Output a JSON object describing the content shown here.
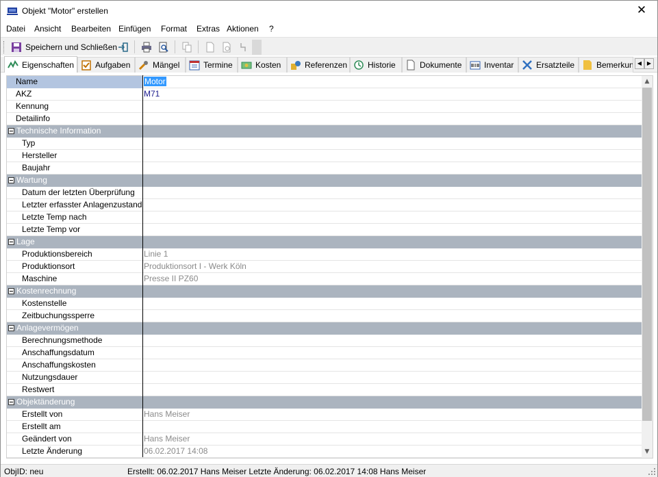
{
  "window": {
    "title": "Objekt \"Motor\" erstellen",
    "close_glyph": "✕"
  },
  "menu": [
    "Datei",
    "Ansicht",
    "Bearbeiten",
    "Einfügen",
    "Format",
    "Extras",
    "Aktionen",
    "?"
  ],
  "toolbar": {
    "save_close_label": "Speichern und Schließen"
  },
  "tabs": [
    {
      "label": "Eigenschaften",
      "icon": "properties-icon",
      "color": "#2e8b57"
    },
    {
      "label": "Aufgaben",
      "icon": "task-icon",
      "color": "#c07000"
    },
    {
      "label": "Mängel",
      "icon": "wrench-icon",
      "color": "#d08000"
    },
    {
      "label": "Termine",
      "icon": "calendar-icon",
      "color": "#3060b0"
    },
    {
      "label": "Kosten",
      "icon": "money-icon",
      "color": "#2e8b57"
    },
    {
      "label": "Referenzen",
      "icon": "references-icon",
      "color": "#c09000"
    },
    {
      "label": "Historie",
      "icon": "history-icon",
      "color": "#2e8b57"
    },
    {
      "label": "Dokumente",
      "icon": "document-icon",
      "color": "#606060"
    },
    {
      "label": "Inventar",
      "icon": "inventory-icon",
      "color": "#3060b0"
    },
    {
      "label": "Ersatzteile",
      "icon": "spare-parts-icon",
      "color": "#3070c0"
    },
    {
      "label": "Bemerkungen",
      "icon": "note-icon",
      "color": "#e0a000"
    }
  ],
  "grid": {
    "rows": [
      {
        "type": "prop",
        "label": "Name",
        "value": "Motor",
        "style": "selected"
      },
      {
        "type": "prop",
        "label": "AKZ",
        "value": "M71",
        "style": "blue"
      },
      {
        "type": "prop",
        "label": "Kennung",
        "value": ""
      },
      {
        "type": "prop",
        "label": "Detailinfo",
        "value": ""
      },
      {
        "type": "sec",
        "label": "Technische Information"
      },
      {
        "type": "sub",
        "label": "Typ",
        "value": ""
      },
      {
        "type": "sub",
        "label": "Hersteller",
        "value": ""
      },
      {
        "type": "sub",
        "label": "Baujahr",
        "value": ""
      },
      {
        "type": "sec",
        "label": "Wartung"
      },
      {
        "type": "sub",
        "label": "Datum der letzten Überprüfung",
        "value": ""
      },
      {
        "type": "sub",
        "label": "Letzter erfasster Anlagenzustand",
        "value": ""
      },
      {
        "type": "sub",
        "label": "Letzte Temp nach",
        "value": ""
      },
      {
        "type": "sub",
        "label": "Letzte Temp vor",
        "value": ""
      },
      {
        "type": "sec",
        "label": "Lage"
      },
      {
        "type": "sub",
        "label": "Produktionsbereich",
        "value": "Linie 1",
        "style": "grey"
      },
      {
        "type": "sub",
        "label": "Produktionsort",
        "value": "Produktionsort I - Werk Köln",
        "style": "grey"
      },
      {
        "type": "sub",
        "label": "Maschine",
        "value": "Presse II PZ60",
        "style": "grey"
      },
      {
        "type": "sec",
        "label": "Kostenrechnung"
      },
      {
        "type": "sub",
        "label": "Kostenstelle",
        "value": ""
      },
      {
        "type": "sub",
        "label": "Zeitbuchungssperre",
        "value": ""
      },
      {
        "type": "sec",
        "label": "Anlagevermögen"
      },
      {
        "type": "sub",
        "label": "Berechnungsmethode",
        "value": ""
      },
      {
        "type": "sub",
        "label": "Anschaffungsdatum",
        "value": ""
      },
      {
        "type": "sub",
        "label": "Anschaffungskosten",
        "value": ""
      },
      {
        "type": "sub",
        "label": "Nutzungsdauer",
        "value": ""
      },
      {
        "type": "sub",
        "label": "Restwert",
        "value": ""
      },
      {
        "type": "sec",
        "label": "Objektänderung"
      },
      {
        "type": "sub",
        "label": "Erstellt von",
        "value": "Hans Meiser",
        "style": "grey"
      },
      {
        "type": "sub",
        "label": "Erstellt am",
        "value": ""
      },
      {
        "type": "sub",
        "label": "Geändert von",
        "value": "Hans Meiser",
        "style": "grey"
      },
      {
        "type": "sub",
        "label": "Letzte Änderung",
        "value": "06.02.2017 14:08",
        "style": "grey"
      }
    ]
  },
  "status": {
    "objid": "ObjID: neu",
    "info": "Erstellt: 06.02.2017 Hans Meiser  Letzte Änderung: 06.02.2017 14:08 Hans Meiser"
  }
}
